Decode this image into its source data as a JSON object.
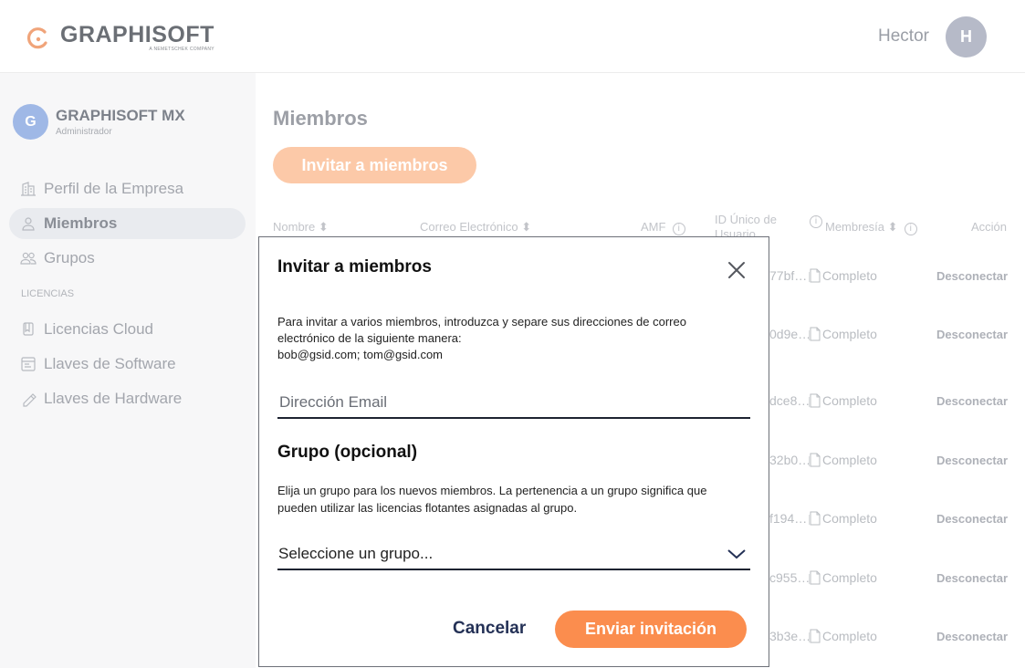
{
  "header": {
    "brand": "GRAPHISOFT",
    "brand_sub": "A NEMETSCHEK COMPANY",
    "user_name": "Hector",
    "user_initial": "H"
  },
  "sidebar": {
    "org_initial": "G",
    "org_name": "GRAPHISOFT MX",
    "org_role": "Administrador",
    "items": [
      {
        "label": "Perfil de la Empresa",
        "icon": "building-icon"
      },
      {
        "label": "Miembros",
        "icon": "user-icon",
        "active": true
      },
      {
        "label": "Grupos",
        "icon": "users-icon"
      }
    ],
    "section_label": "LICENCIAS",
    "license_items": [
      {
        "label": "Licencias Cloud",
        "icon": "license-icon"
      },
      {
        "label": "Llaves de Software",
        "icon": "software-key-icon"
      },
      {
        "label": "Llaves de Hardware",
        "icon": "hardware-key-icon"
      }
    ]
  },
  "main": {
    "title": "Miembros",
    "invite_button": "Invitar a miembros",
    "columns": {
      "nombre": "Nombre",
      "correo": "Correo Electrónico",
      "amf": "AMF",
      "id": "ID Único de Usuario",
      "membresia": "Membresía",
      "accion": "Acción"
    },
    "rows": [
      {
        "id": "77bf…",
        "membership": "Completo",
        "action": "Desconectar"
      },
      {
        "id": "0d9e…",
        "membership": "Completo",
        "action": "Desconectar"
      },
      {
        "id": "dce8…",
        "membership": "Completo",
        "action": "Desconectar"
      },
      {
        "id": "32b0…",
        "membership": "Completo",
        "action": "Desconectar"
      },
      {
        "id": "f194…",
        "membership": "Completo",
        "action": "Desconectar"
      },
      {
        "id": "c955…",
        "membership": "Completo",
        "action": "Desconectar"
      },
      {
        "id": "3b3e…",
        "membership": "Completo",
        "action": "Desconectar"
      }
    ]
  },
  "modal": {
    "title": "Invitar a miembros",
    "description_line1": "Para invitar a varios miembros, introduzca y separe sus direcciones de correo electrónico de la siguiente manera:",
    "description_example": "bob@gsid.com; tom@gsid.com",
    "email_placeholder": "Dirección Email",
    "group_title": "Grupo (opcional)",
    "group_description": "Elija un grupo para los nuevos miembros. La pertenencia a un grupo significa que pueden utilizar las licencias flotantes asignadas al grupo.",
    "group_select_value": "Seleccione un grupo...",
    "cancel": "Cancelar",
    "send": "Enviar invitación"
  },
  "colors": {
    "accent": "#fb8d4e",
    "accent_faded": "#fcc9a8",
    "dark_text": "#243156"
  }
}
